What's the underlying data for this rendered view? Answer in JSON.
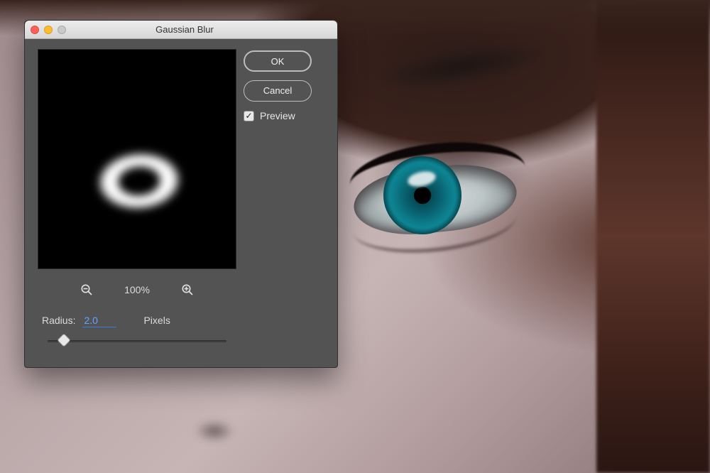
{
  "dialog": {
    "title": "Gaussian Blur",
    "ok_label": "OK",
    "cancel_label": "Cancel",
    "preview_label": "Preview",
    "preview_checked": true,
    "zoom_level": "100%",
    "radius_label": "Radius:",
    "radius_value": "2.0",
    "radius_unit": "Pixels"
  },
  "icons": {
    "zoom_out": "zoom-out-icon",
    "zoom_in": "zoom-in-icon",
    "checkmark": "✓"
  }
}
